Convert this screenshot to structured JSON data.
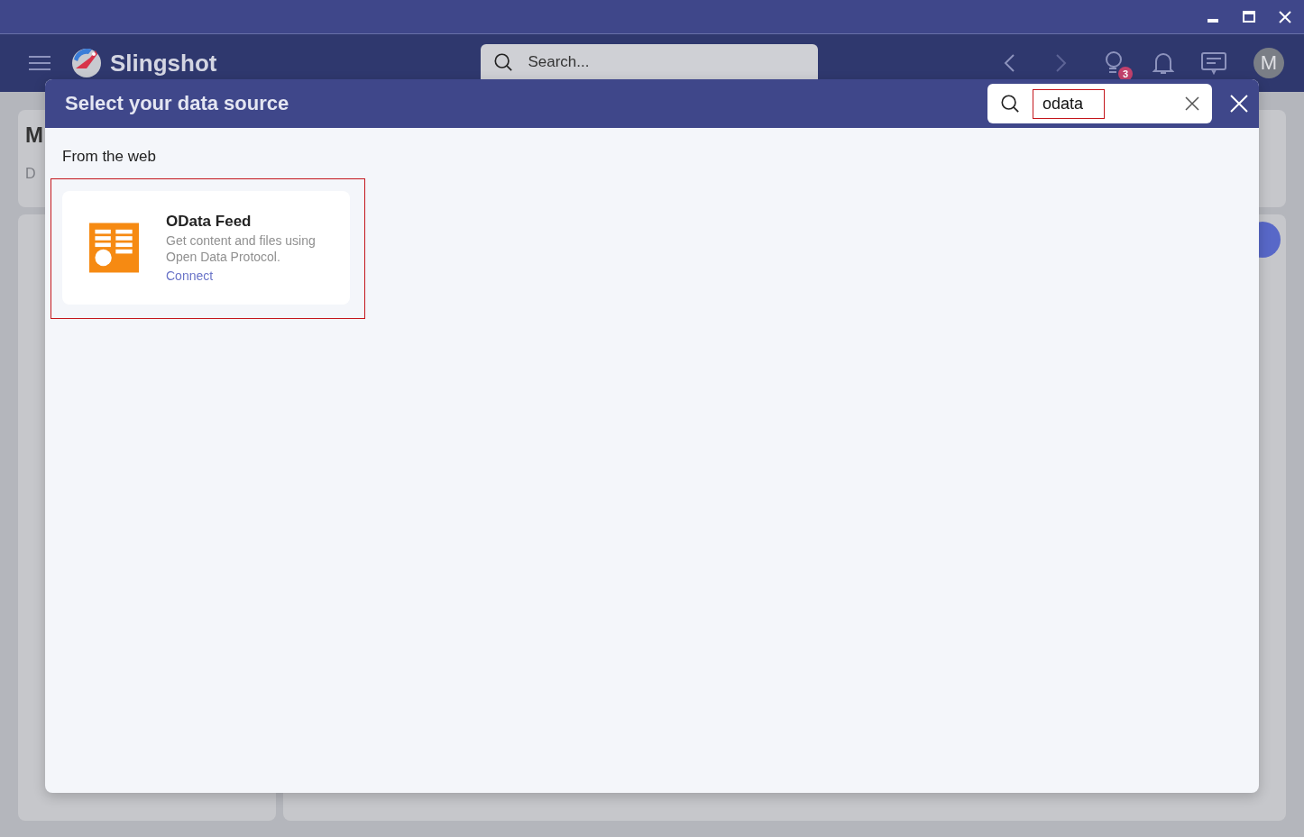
{
  "app_bar": {
    "brand": "Slingshot",
    "search": {
      "placeholder": "Search..."
    },
    "tips_badge": "3",
    "avatar": "M"
  },
  "background": {
    "card_title": "M",
    "card_subtitle": "D"
  },
  "dialog": {
    "title": "Select your data source",
    "search": {
      "value": "odata",
      "highlighted": true
    },
    "section": "From the web",
    "sources": [
      {
        "name": "OData Feed",
        "description": "Get content and files using Open Data Protocol.",
        "action": "Connect",
        "highlighted": true
      }
    ]
  }
}
